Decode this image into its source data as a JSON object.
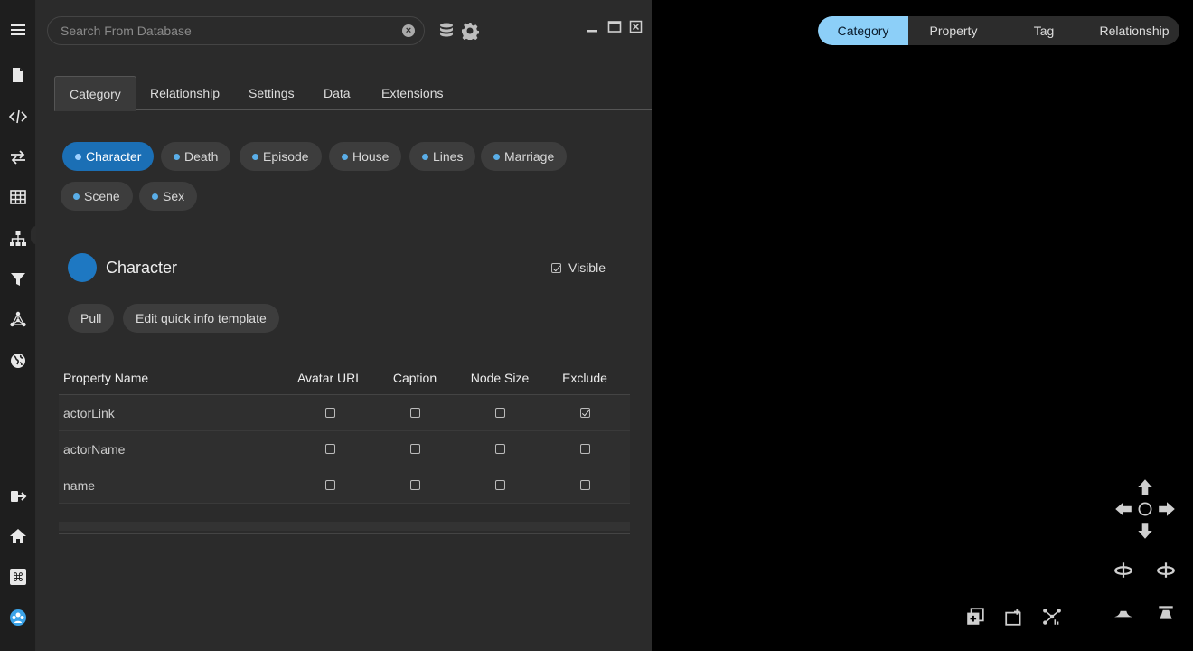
{
  "search": {
    "placeholder": "Search From Database"
  },
  "tabs": [
    {
      "label": "Category"
    },
    {
      "label": "Relationship"
    },
    {
      "label": "Settings"
    },
    {
      "label": "Data"
    },
    {
      "label": "Extensions"
    }
  ],
  "chips": [
    {
      "label": "Character"
    },
    {
      "label": "Death"
    },
    {
      "label": "Episode"
    },
    {
      "label": "House"
    },
    {
      "label": "Lines"
    },
    {
      "label": "Marriage"
    },
    {
      "label": "Scene"
    },
    {
      "label": "Sex"
    }
  ],
  "category": {
    "name": "Character",
    "visible_label": "Visible",
    "visible_checked": true,
    "pull_label": "Pull",
    "edit_label": "Edit quick info template",
    "color": "#1e78c2"
  },
  "table": {
    "headers": [
      "Property Name",
      "Avatar URL",
      "Caption",
      "Node Size",
      "Exclude"
    ],
    "rows": [
      {
        "name": "actorLink",
        "avatar": false,
        "caption": false,
        "size": false,
        "exclude": true
      },
      {
        "name": "actorName",
        "avatar": false,
        "caption": false,
        "size": false,
        "exclude": false
      },
      {
        "name": "name",
        "avatar": false,
        "caption": false,
        "size": false,
        "exclude": false
      }
    ]
  },
  "view_modes": [
    {
      "label": "Category"
    },
    {
      "label": "Property"
    },
    {
      "label": "Tag"
    },
    {
      "label": "Relationship"
    }
  ],
  "colors": {
    "accent": "#1b6fb5",
    "segment_active": "#8ccff8",
    "panel": "#2b2b2b"
  }
}
